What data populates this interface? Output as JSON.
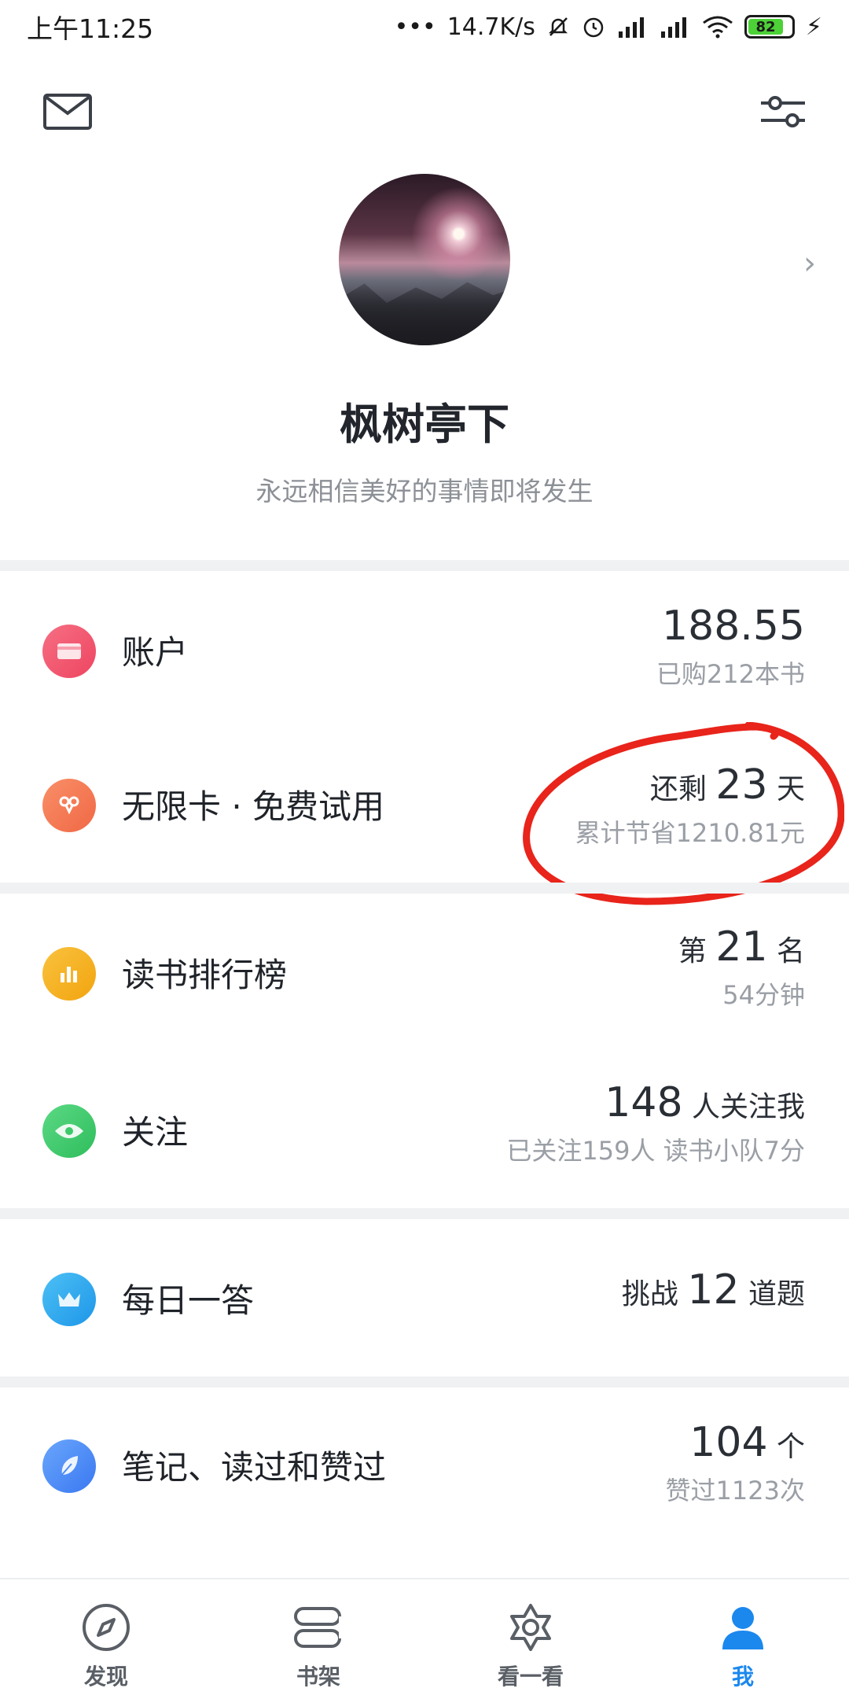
{
  "status_bar": {
    "time": "上午11:25",
    "net_speed": "14.7K/s",
    "battery": "82"
  },
  "profile": {
    "name": "枫树亭下",
    "signature": "永远相信美好的事情即将发生"
  },
  "rows": {
    "account": {
      "label": "账户",
      "value": "188.55",
      "sub": "已购212本书"
    },
    "unlimited": {
      "label": "无限卡 · 免费试用",
      "value_prefix": "还剩 ",
      "value": "23",
      "value_suffix": " 天",
      "sub": "累计节省1210.81元"
    },
    "ranking": {
      "label": "读书排行榜",
      "value_prefix": "第 ",
      "value": "21",
      "value_suffix": " 名",
      "sub": "54分钟"
    },
    "follow": {
      "label": "关注",
      "value": "148",
      "value_suffix": " 人关注我",
      "sub": "已关注159人 读书小队7分"
    },
    "daily": {
      "label": "每日一答",
      "value_prefix": "挑战 ",
      "value": "12",
      "value_suffix": " 道题"
    },
    "notes": {
      "label": "笔记、读过和赞过",
      "value": "104",
      "value_suffix": " 个",
      "sub": "赞过1123次"
    }
  },
  "bottom_nav": [
    {
      "label": "发现",
      "icon": "compass-icon"
    },
    {
      "label": "书架",
      "icon": "bookshelf-icon"
    },
    {
      "label": "看一看",
      "icon": "star-flower-icon"
    },
    {
      "label": "我",
      "icon": "person-icon",
      "active": true
    }
  ],
  "colors": {
    "accent": "#1b88ee",
    "account_icon": "#f2566e",
    "unlimited_icon": "#f47a55",
    "ranking_icon": "#f6b21e",
    "follow_icon": "#3cc96a",
    "daily_icon": "#2aa8f0",
    "notes_icon": "#4a8cf7",
    "annotation": "#e8241b"
  }
}
